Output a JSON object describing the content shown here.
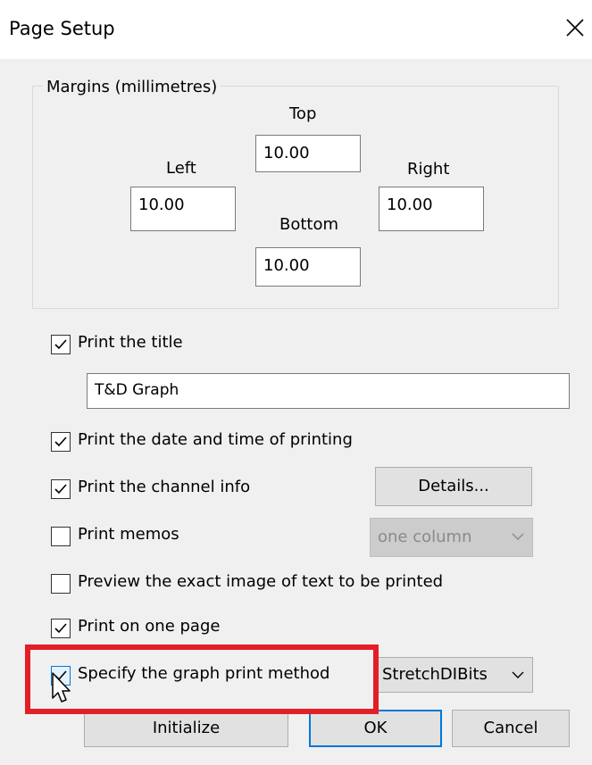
{
  "window": {
    "title": "Page Setup"
  },
  "margins": {
    "group_label": "Margins (millimetres)",
    "top_label": "Top",
    "top_value": "10.00",
    "left_label": "Left",
    "left_value": "10.00",
    "right_label": "Right",
    "right_value": "10.00",
    "bottom_label": "Bottom",
    "bottom_value": "10.00"
  },
  "options": {
    "print_title": {
      "label": "Print the title",
      "checked": true,
      "value": "T&D Graph"
    },
    "print_date": {
      "label": "Print the date and time of printing",
      "checked": true
    },
    "print_channel": {
      "label": "Print the channel info",
      "checked": true,
      "details_label": "Details..."
    },
    "print_memos": {
      "label": "Print memos",
      "checked": false,
      "combo_value": "one column"
    },
    "preview_exact": {
      "label": "Preview the exact image of text to be printed",
      "checked": false
    },
    "print_one_page": {
      "label": "Print on one page",
      "checked": true
    },
    "specify_method": {
      "label": "Specify the graph print method",
      "checked": true,
      "combo_value": "StretchDIBits"
    }
  },
  "buttons": {
    "initialize": "Initialize",
    "ok": "OK",
    "cancel": "Cancel"
  },
  "colors": {
    "highlight_box": "#e41e26",
    "accent": "#0078d7"
  },
  "icons": [
    "close-icon",
    "check-icon",
    "chevron-down-icon",
    "mouse-cursor-icon"
  ]
}
